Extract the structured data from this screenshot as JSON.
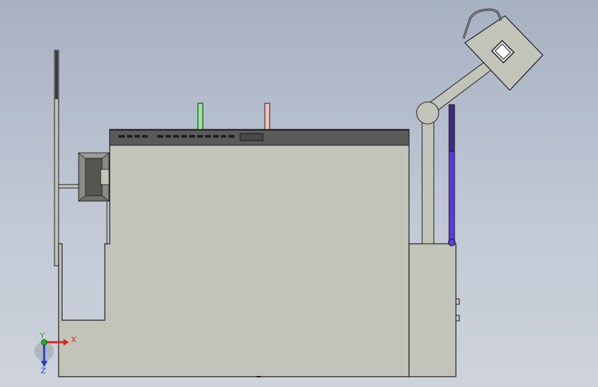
{
  "viewport": {
    "background_top": "#a6b1c3",
    "background_bottom": "#ced3dc",
    "part_fill": "#c3c4b9",
    "part_stroke": "#1a1a1a",
    "panel_fill": "#5a5a5a"
  },
  "triad": {
    "x_label": "X",
    "y_label": "Y",
    "z_label": "Z",
    "x_color": "#e02020",
    "y_color": "#20b020",
    "z_color": "#2040d0"
  },
  "markers": {
    "green_color": "#90f090",
    "salmon_color": "#f8c0b0",
    "level_tube_color": "#3a2a8a",
    "level_fill_color": "#5a3ae0",
    "level_fraction": 0.66
  }
}
